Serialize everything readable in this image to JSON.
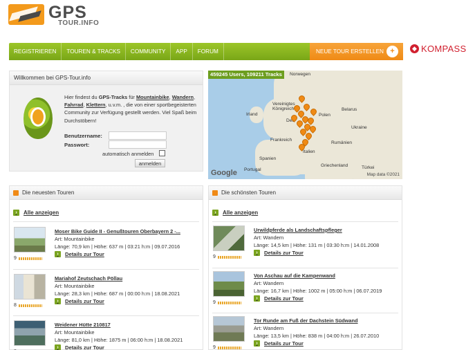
{
  "header": {
    "logo_main": "GPS",
    "logo_sub": "TOUR.INFO",
    "partner": "KOMPASS"
  },
  "nav": {
    "items": [
      "REGISTRIEREN",
      "TOUREN & TRACKS",
      "COMMUNITY",
      "APP",
      "FORUM"
    ],
    "new_tour": "NEUE TOUR ERSTELLEN"
  },
  "welcome": {
    "title": "Willkommen bei GPS-Tour.info",
    "text_parts": [
      "Hier findest du ",
      "GPS-Tracks",
      " für ",
      "Mountainbike",
      ", ",
      "Wandern",
      ", ",
      "Fahrrad",
      ", ",
      "Klettern",
      ", u.v.m. , die von einer sportbegeisterten Community zur Verfügung gestellt werden. Viel Spaß beim Durchstöbern!"
    ],
    "username_label": "Benutzername:",
    "password_label": "Passwort:",
    "auto_login": "automatisch anmelden",
    "login_button": "anmelden"
  },
  "map": {
    "stats": "459245 Users, 109211 Tracks",
    "labels": [
      "Norwegen",
      "Vereinigtes Königreich",
      "Irland",
      "Belarus",
      "Polen",
      "Deu",
      "Ukraine",
      "Frankreich",
      "Rumänien",
      "Italien",
      "Spanien",
      "Portugal",
      "Griechenland",
      "Türkei"
    ],
    "attribution": "Map data ©2021",
    "brand": "Google"
  },
  "newest": {
    "title": "Die neuesten Touren",
    "show_all": "Alle anzeigen",
    "tours": [
      {
        "title": "Moser Bike Guide II - Genußtouren Oberbayern 2 -...",
        "art": "Art: Mountainbike",
        "stats": "Länge: 70,9 km | Höhe: 637 m | 03:21 h:m | 09.07.2016",
        "details": "Details zur Tour",
        "rating": "9"
      },
      {
        "title": "Mariahof Zeutschach Pöllau",
        "art": "Art: Mountainbike",
        "stats": "Länge: 28,3 km | Höhe: 687 m | 00:00 h:m | 18.08.2021",
        "details": "Details zur Tour",
        "rating": "8"
      },
      {
        "title": "Weidener Hütte 210817",
        "art": "Art: Mountainbike",
        "stats": "Länge: 81,0 km | Höhe: 1875 m | 06:00 h:m | 18.08.2021",
        "details": "Details zur Tour",
        "rating": "8"
      }
    ]
  },
  "best": {
    "title": "Die schönsten Touren",
    "show_all": "Alle anzeigen",
    "tours": [
      {
        "title": "Urwildpferde als Landschaftspfleger",
        "art": "Art: Wandern",
        "stats": "Länge: 14,5 km | Höhe: 131 m | 03:30 h:m | 14.01.2008",
        "details": "Details zur Tour",
        "rating": "9"
      },
      {
        "title": "Von Aschau auf die Kampenwand",
        "art": "Art: Wandern",
        "stats": "Länge: 16,7 km | Höhe: 1002 m | 05:00 h:m | 06.07.2019",
        "details": "Details zur Tour",
        "rating": "9"
      },
      {
        "title": "Tor Runde am Fuß der Dachstein Südwand",
        "art": "Art: Wandern",
        "stats": "Länge: 13,5 km | Höhe: 838 m | 04:00 h:m | 26.07.2010",
        "details": "Details zur Tour",
        "rating": "9"
      }
    ]
  }
}
